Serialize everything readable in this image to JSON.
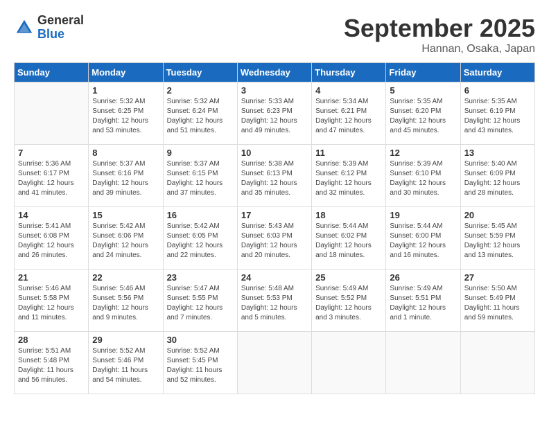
{
  "header": {
    "logo_general": "General",
    "logo_blue": "Blue",
    "month_title": "September 2025",
    "location": "Hannan, Osaka, Japan"
  },
  "weekdays": [
    "Sunday",
    "Monday",
    "Tuesday",
    "Wednesday",
    "Thursday",
    "Friday",
    "Saturday"
  ],
  "weeks": [
    [
      {
        "day": "",
        "info": ""
      },
      {
        "day": "1",
        "info": "Sunrise: 5:32 AM\nSunset: 6:25 PM\nDaylight: 12 hours\nand 53 minutes."
      },
      {
        "day": "2",
        "info": "Sunrise: 5:32 AM\nSunset: 6:24 PM\nDaylight: 12 hours\nand 51 minutes."
      },
      {
        "day": "3",
        "info": "Sunrise: 5:33 AM\nSunset: 6:23 PM\nDaylight: 12 hours\nand 49 minutes."
      },
      {
        "day": "4",
        "info": "Sunrise: 5:34 AM\nSunset: 6:21 PM\nDaylight: 12 hours\nand 47 minutes."
      },
      {
        "day": "5",
        "info": "Sunrise: 5:35 AM\nSunset: 6:20 PM\nDaylight: 12 hours\nand 45 minutes."
      },
      {
        "day": "6",
        "info": "Sunrise: 5:35 AM\nSunset: 6:19 PM\nDaylight: 12 hours\nand 43 minutes."
      }
    ],
    [
      {
        "day": "7",
        "info": "Sunrise: 5:36 AM\nSunset: 6:17 PM\nDaylight: 12 hours\nand 41 minutes."
      },
      {
        "day": "8",
        "info": "Sunrise: 5:37 AM\nSunset: 6:16 PM\nDaylight: 12 hours\nand 39 minutes."
      },
      {
        "day": "9",
        "info": "Sunrise: 5:37 AM\nSunset: 6:15 PM\nDaylight: 12 hours\nand 37 minutes."
      },
      {
        "day": "10",
        "info": "Sunrise: 5:38 AM\nSunset: 6:13 PM\nDaylight: 12 hours\nand 35 minutes."
      },
      {
        "day": "11",
        "info": "Sunrise: 5:39 AM\nSunset: 6:12 PM\nDaylight: 12 hours\nand 32 minutes."
      },
      {
        "day": "12",
        "info": "Sunrise: 5:39 AM\nSunset: 6:10 PM\nDaylight: 12 hours\nand 30 minutes."
      },
      {
        "day": "13",
        "info": "Sunrise: 5:40 AM\nSunset: 6:09 PM\nDaylight: 12 hours\nand 28 minutes."
      }
    ],
    [
      {
        "day": "14",
        "info": "Sunrise: 5:41 AM\nSunset: 6:08 PM\nDaylight: 12 hours\nand 26 minutes."
      },
      {
        "day": "15",
        "info": "Sunrise: 5:42 AM\nSunset: 6:06 PM\nDaylight: 12 hours\nand 24 minutes."
      },
      {
        "day": "16",
        "info": "Sunrise: 5:42 AM\nSunset: 6:05 PM\nDaylight: 12 hours\nand 22 minutes."
      },
      {
        "day": "17",
        "info": "Sunrise: 5:43 AM\nSunset: 6:03 PM\nDaylight: 12 hours\nand 20 minutes."
      },
      {
        "day": "18",
        "info": "Sunrise: 5:44 AM\nSunset: 6:02 PM\nDaylight: 12 hours\nand 18 minutes."
      },
      {
        "day": "19",
        "info": "Sunrise: 5:44 AM\nSunset: 6:00 PM\nDaylight: 12 hours\nand 16 minutes."
      },
      {
        "day": "20",
        "info": "Sunrise: 5:45 AM\nSunset: 5:59 PM\nDaylight: 12 hours\nand 13 minutes."
      }
    ],
    [
      {
        "day": "21",
        "info": "Sunrise: 5:46 AM\nSunset: 5:58 PM\nDaylight: 12 hours\nand 11 minutes."
      },
      {
        "day": "22",
        "info": "Sunrise: 5:46 AM\nSunset: 5:56 PM\nDaylight: 12 hours\nand 9 minutes."
      },
      {
        "day": "23",
        "info": "Sunrise: 5:47 AM\nSunset: 5:55 PM\nDaylight: 12 hours\nand 7 minutes."
      },
      {
        "day": "24",
        "info": "Sunrise: 5:48 AM\nSunset: 5:53 PM\nDaylight: 12 hours\nand 5 minutes."
      },
      {
        "day": "25",
        "info": "Sunrise: 5:49 AM\nSunset: 5:52 PM\nDaylight: 12 hours\nand 3 minutes."
      },
      {
        "day": "26",
        "info": "Sunrise: 5:49 AM\nSunset: 5:51 PM\nDaylight: 12 hours\nand 1 minute."
      },
      {
        "day": "27",
        "info": "Sunrise: 5:50 AM\nSunset: 5:49 PM\nDaylight: 11 hours\nand 59 minutes."
      }
    ],
    [
      {
        "day": "28",
        "info": "Sunrise: 5:51 AM\nSunset: 5:48 PM\nDaylight: 11 hours\nand 56 minutes."
      },
      {
        "day": "29",
        "info": "Sunrise: 5:52 AM\nSunset: 5:46 PM\nDaylight: 11 hours\nand 54 minutes."
      },
      {
        "day": "30",
        "info": "Sunrise: 5:52 AM\nSunset: 5:45 PM\nDaylight: 11 hours\nand 52 minutes."
      },
      {
        "day": "",
        "info": ""
      },
      {
        "day": "",
        "info": ""
      },
      {
        "day": "",
        "info": ""
      },
      {
        "day": "",
        "info": ""
      }
    ]
  ]
}
